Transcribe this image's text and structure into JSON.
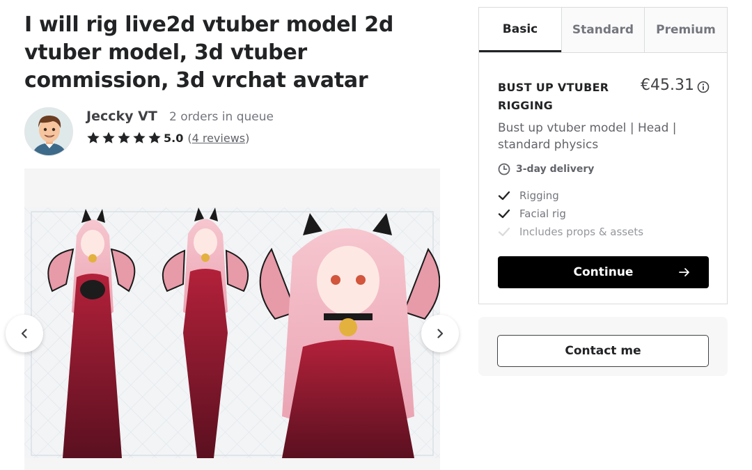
{
  "gig": {
    "title": "I will rig live2d vtuber model 2d vtuber model, 3d vtuber commission, 3d vrchat avatar"
  },
  "seller": {
    "name": "Jeccky VT",
    "queue": "2 orders in queue",
    "rating": "5.0",
    "reviews_prefix": "(",
    "reviews_link": "4 reviews",
    "reviews_suffix": ")",
    "star_color": "#222325"
  },
  "gallery": {
    "prev_icon": "chevron-left-icon",
    "next_icon": "chevron-right-icon"
  },
  "packages": {
    "tabs": [
      {
        "label": "Basic",
        "active": true
      },
      {
        "label": "Standard",
        "active": false
      },
      {
        "label": "Premium",
        "active": false
      }
    ],
    "selected": {
      "name": "BUST UP VTUBER RIGGING",
      "price": "€45.31",
      "description": "Bust up vtuber model | Head | standard physics",
      "delivery": "3-day delivery",
      "features": [
        {
          "label": "Rigging",
          "included": true
        },
        {
          "label": "Facial rig",
          "included": true
        },
        {
          "label": "Includes props & assets",
          "included": false
        }
      ]
    },
    "continue_label": "Continue",
    "contact_label": "Contact me"
  }
}
